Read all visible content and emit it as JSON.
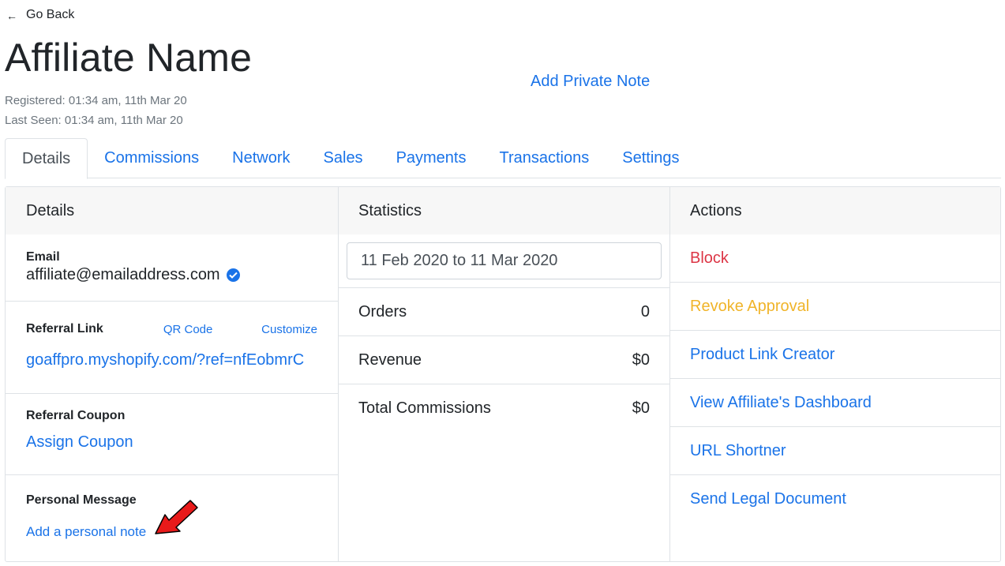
{
  "header": {
    "back_label": "Go Back",
    "title": "Affiliate Name",
    "private_note_label": "Add Private Note",
    "registered": "Registered: 01:34 am, 11th Mar 20",
    "last_seen": "Last Seen: 01:34 am, 11th Mar 20"
  },
  "tabs": [
    {
      "label": "Details",
      "active": true
    },
    {
      "label": "Commissions"
    },
    {
      "label": "Network"
    },
    {
      "label": "Sales"
    },
    {
      "label": "Payments"
    },
    {
      "label": "Transactions"
    },
    {
      "label": "Settings"
    }
  ],
  "details": {
    "heading": "Details",
    "email_label": "Email",
    "email_value": "affiliate@emailaddress.com",
    "referral_label": "Referral Link",
    "qr_label": "QR Code",
    "customize_label": "Customize",
    "referral_link": "goaffpro.myshopify.com/?ref=nfEobmrC",
    "coupon_label": "Referral Coupon",
    "assign_coupon": "Assign Coupon",
    "message_label": "Personal Message",
    "add_note": "Add a personal note"
  },
  "statistics": {
    "heading": "Statistics",
    "date_range": "11 Feb 2020 to 11 Mar 2020",
    "rows": [
      {
        "label": "Orders",
        "value": "0"
      },
      {
        "label": "Revenue",
        "value": "$0"
      },
      {
        "label": "Total Commissions",
        "value": "$0"
      }
    ]
  },
  "actions": {
    "heading": "Actions",
    "items": [
      {
        "label": "Block",
        "color": "#dc3545"
      },
      {
        "label": "Revoke Approval",
        "color": "#f0b429"
      },
      {
        "label": "Product Link Creator",
        "color": "#1a73e8"
      },
      {
        "label": "View Affiliate's Dashboard",
        "color": "#1a73e8"
      },
      {
        "label": "URL Shortner",
        "color": "#1a73e8"
      },
      {
        "label": "Send Legal Document",
        "color": "#1a73e8"
      }
    ]
  },
  "colors": {
    "link": "#1a73e8",
    "annotation_arrow": "#e81a1a"
  }
}
